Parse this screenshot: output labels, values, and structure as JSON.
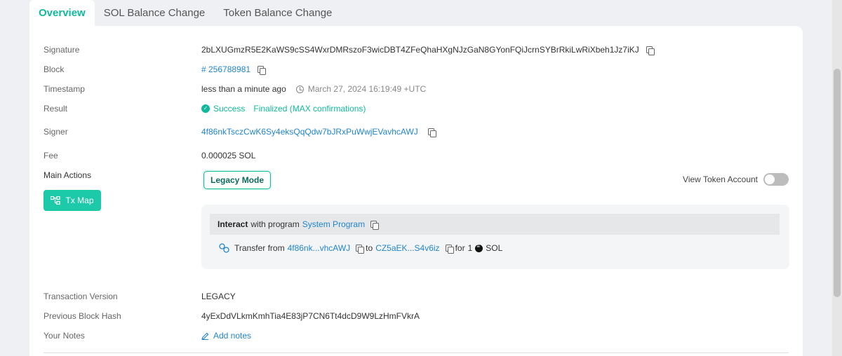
{
  "tabs": [
    {
      "label": "Overview"
    },
    {
      "label": "SOL Balance Change"
    },
    {
      "label": "Token Balance Change"
    }
  ],
  "fields": {
    "signature": {
      "label": "Signature",
      "value": "2bLXUGmzR5E2KaWS9cSS4WxrDMRszoF3wicDBT4ZFeQhaHXgNJzGaN8GYonFQiJcrnSYBrRkiLwRiXbeh1Jz7iKJ"
    },
    "block": {
      "label": "Block",
      "value": "# 256788981"
    },
    "timestamp": {
      "label": "Timestamp",
      "relative": "less than a minute ago",
      "absolute": "March 27, 2024 16:19:49 +UTC"
    },
    "result": {
      "label": "Result",
      "status": "Success",
      "confirmations": "Finalized (MAX confirmations)"
    },
    "signer": {
      "label": "Signer",
      "value": "4f86nkTsczCwK6Sy4eksQqQdw7bJRxPuWwjEVavhcAWJ"
    },
    "fee": {
      "label": "Fee",
      "value": "0.000025 SOL"
    },
    "main_actions": {
      "label": "Main Actions"
    },
    "tx_version": {
      "label": "Transaction Version",
      "value": "LEGACY"
    },
    "prev_hash": {
      "label": "Previous Block Hash",
      "value": "4yExDdVLkmKmhTia4E83jP7CN6Tt4dcD9W9LzHmFVkrA"
    },
    "notes": {
      "label": "Your Notes",
      "action": "Add notes"
    }
  },
  "buttons": {
    "legacy_mode": "Legacy Mode",
    "tx_map": "Tx Map",
    "view_token_account": "View Token Account"
  },
  "interaction": {
    "verb": "Interact",
    "with_text": "with program",
    "program": "System Program",
    "transfer_from": "Transfer from",
    "from_addr": "4f86nk...vhcAWJ",
    "to_text": "to",
    "to_addr": "CZ5aEK...S4v6iz",
    "for_text": "for",
    "amount": "1",
    "token": "SOL"
  },
  "colors": {
    "accent": "#10b99e",
    "link": "#2185d0",
    "button": "#1cc9a8"
  }
}
